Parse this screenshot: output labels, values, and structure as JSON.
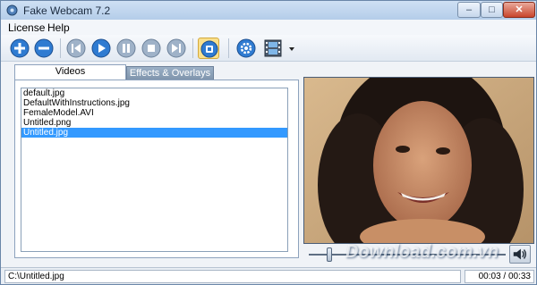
{
  "window": {
    "title": "Fake Webcam 7.2"
  },
  "menu": {
    "license": "License",
    "help": "Help"
  },
  "toolbar": {
    "buttons": [
      "add-icon",
      "remove-icon",
      "skip-back-icon",
      "play-icon",
      "pause-icon",
      "stop-icon",
      "skip-forward-icon",
      "record-icon",
      "settings-icon",
      "filmstrip-icon"
    ],
    "accent": "#2f7bd1",
    "active_highlight": "#f9e08d"
  },
  "tabs": {
    "videos": "Videos",
    "effects": "Effects & Overlays"
  },
  "files": [
    "default.jpg",
    "DefaultWithInstructions.jpg",
    "FemaleModel.AVI",
    "Untitled.png",
    "Untitled.jpg"
  ],
  "selected_file_index": 4,
  "player": {
    "position_fraction": 0.09
  },
  "watermark": "Download.com.vn",
  "status": {
    "path": "C:\\Untitled.jpg",
    "time": "00:03 / 00:33"
  }
}
